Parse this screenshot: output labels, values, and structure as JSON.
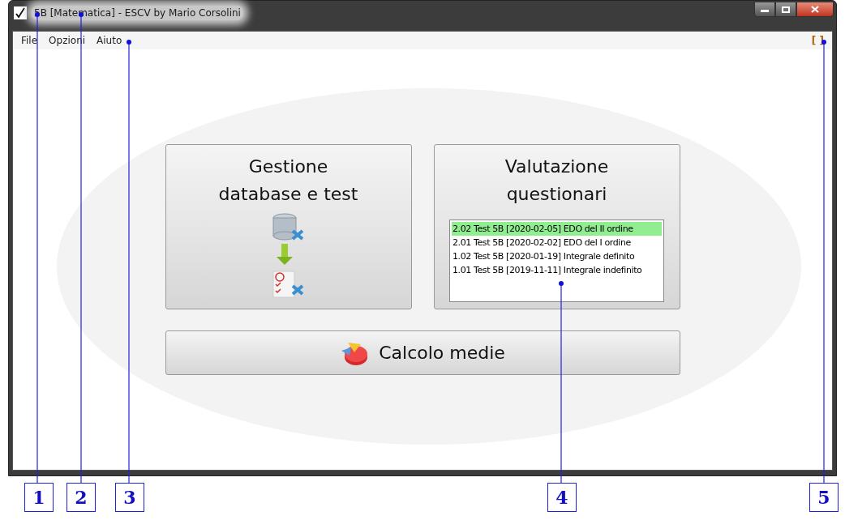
{
  "window": {
    "title": "5B [Matematica] - ESCV by Mario Corsolini"
  },
  "menu": {
    "items": [
      "File",
      "Opzioni",
      "Aiuto"
    ],
    "indicator": "[ ]"
  },
  "tiles": [
    {
      "kind": "database",
      "title_lines": [
        "Gestione",
        "database e test"
      ]
    },
    {
      "kind": "list",
      "title_lines": [
        "Valutazione",
        "questionari"
      ],
      "items": [
        {
          "label": "2.02 Test 5B [2020-02-05] EDO del II ordine",
          "selected": true
        },
        {
          "label": "2.01 Test 5B [2020-02-02] EDO del I ordine",
          "selected": false
        },
        {
          "label": "1.02 Test 5B [2020-01-19] Integrale definito",
          "selected": false
        },
        {
          "label": "1.01 Test 5B [2019-11-11] Integrale indefinito",
          "selected": false
        }
      ]
    }
  ],
  "wide_button": {
    "label": "Calcolo medie"
  },
  "callouts": [
    {
      "label": "1"
    },
    {
      "label": "2"
    },
    {
      "label": "3"
    },
    {
      "label": "4"
    },
    {
      "label": "5"
    }
  ]
}
